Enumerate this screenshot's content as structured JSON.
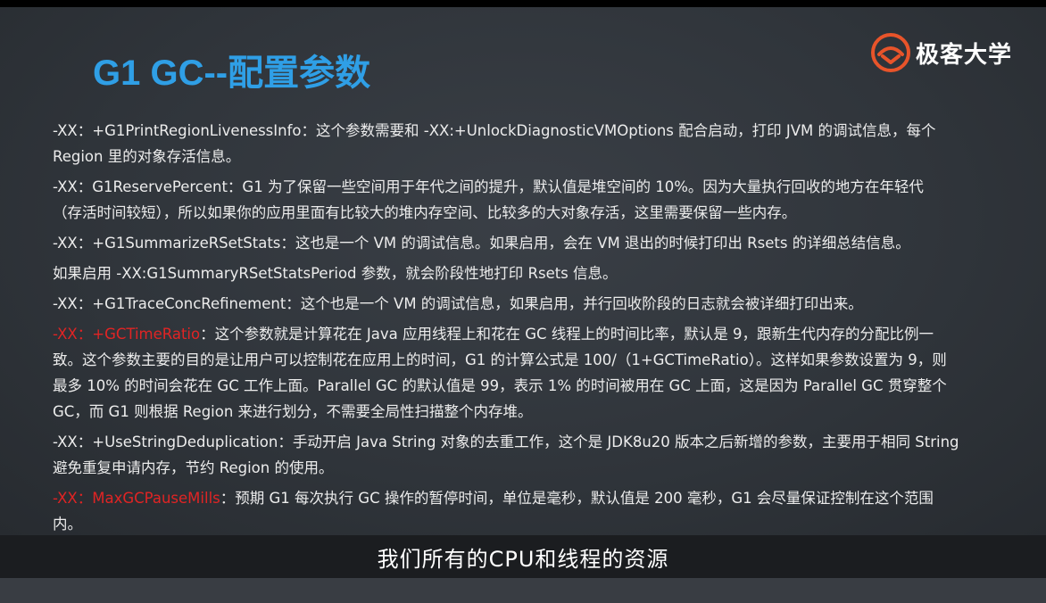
{
  "logo": {
    "text": "极客大学",
    "icon": "geekbang-logo-icon",
    "color": "#e8542a"
  },
  "title": "G1 GC--配置参数",
  "colors": {
    "title": "#2f9fe6",
    "highlight": "#e02424",
    "text": "#ececec"
  },
  "paragraphs": [
    {
      "lines": [
        "-XX：+G1PrintRegionLivenessInfo：这个参数需要和 -XX:+UnlockDiagnosticVMOptions 配合启动，打印 JVM 的调试信息，每个",
        "Region 里的对象存活信息。"
      ]
    },
    {
      "lines": [
        "-XX：G1ReservePercent：G1 为了保留一些空间用于年代之间的提升，默认值是堆空间的 10%。因为大量执行回收的地方在年轻代",
        "（存活时间较短），所以如果你的应用里面有比较大的堆内存空间、比较多的大对象存活，这里需要保留一些内存。"
      ]
    },
    {
      "lines": [
        "-XX：+G1SummarizeRSetStats：这也是一个 VM 的调试信息。如果启用，会在 VM 退出的时候打印出 Rsets 的详细总结信息。"
      ]
    },
    {
      "lines": [
        "如果启用 -XX:G1SummaryRSetStatsPeriod 参数，就会阶段性地打印 Rsets 信息。"
      ]
    },
    {
      "lines": [
        "-XX：+G1TraceConcRefinement：这个也是一个 VM 的调试信息，如果启用，并行回收阶段的日志就会被详细打印出来。"
      ]
    },
    {
      "highlight": "-XX：+GCTimeRatio",
      "first_rest": "：这个参数就是计算花在 Java 应用线程上和花在 GC 线程上的时间比率，默认是 9，跟新生代内存的分配比例一",
      "lines": [
        "致。这个参数主要的目的是让用户可以控制花在应用上的时间，G1 的计算公式是 100/（1+GCTimeRatio）。这样如果参数设置为 9，则",
        "最多 10% 的时间会花在 GC 工作上面。Parallel GC 的默认值是 99，表示 1% 的时间被用在 GC 上面，这是因为 Parallel GC 贯穿整个",
        "GC，而 G1 则根据 Region 来进行划分，不需要全局性扫描整个内存堆。"
      ]
    },
    {
      "lines": [
        "-XX：+UseStringDeduplication：手动开启 Java String 对象的去重工作，这个是  JDK8u20 版本之后新增的参数，主要用于相同 String",
        "避免重复申请内存，节约 Region 的使用。"
      ]
    },
    {
      "highlight": "-XX：MaxGCPauseMills",
      "first_rest": "：预期 G1 每次执行 GC 操作的暂停时间，单位是毫秒，默认值是 200 毫秒，G1 会尽量保证控制在这个范围",
      "lines": [
        "内。"
      ]
    }
  ],
  "subtitle": "我们所有的CPU和线程的资源"
}
